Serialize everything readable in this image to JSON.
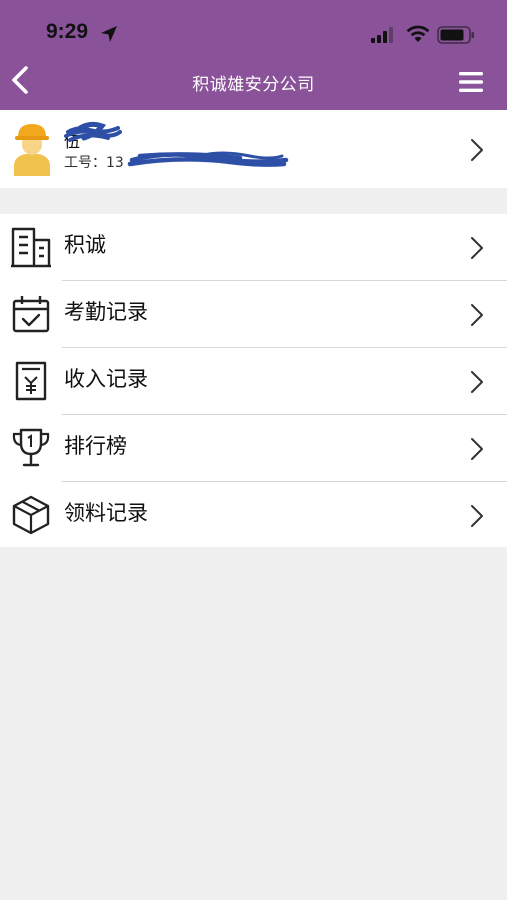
{
  "status_bar": {
    "time": "9:29",
    "icons": [
      "location-arrow-icon",
      "signal-icon",
      "wifi-icon",
      "battery-icon"
    ]
  },
  "nav_bar": {
    "title": "积诚雄安分公司",
    "back_icon": "chevron-left-icon",
    "menu_icon": "hamburger-menu-icon",
    "color": "#8a5399"
  },
  "profile": {
    "name": "伍",
    "id_label": "工号：13",
    "avatar_icon": "worker-avatar-icon"
  },
  "menu": {
    "items": [
      {
        "label": "积诚",
        "icon": "building-icon"
      },
      {
        "label": "考勤记录",
        "icon": "calendar-check-icon"
      },
      {
        "label": "收入记录",
        "icon": "receipt-yen-icon"
      },
      {
        "label": "排行榜",
        "icon": "trophy-icon"
      },
      {
        "label": "领料记录",
        "icon": "box-icon"
      }
    ]
  }
}
